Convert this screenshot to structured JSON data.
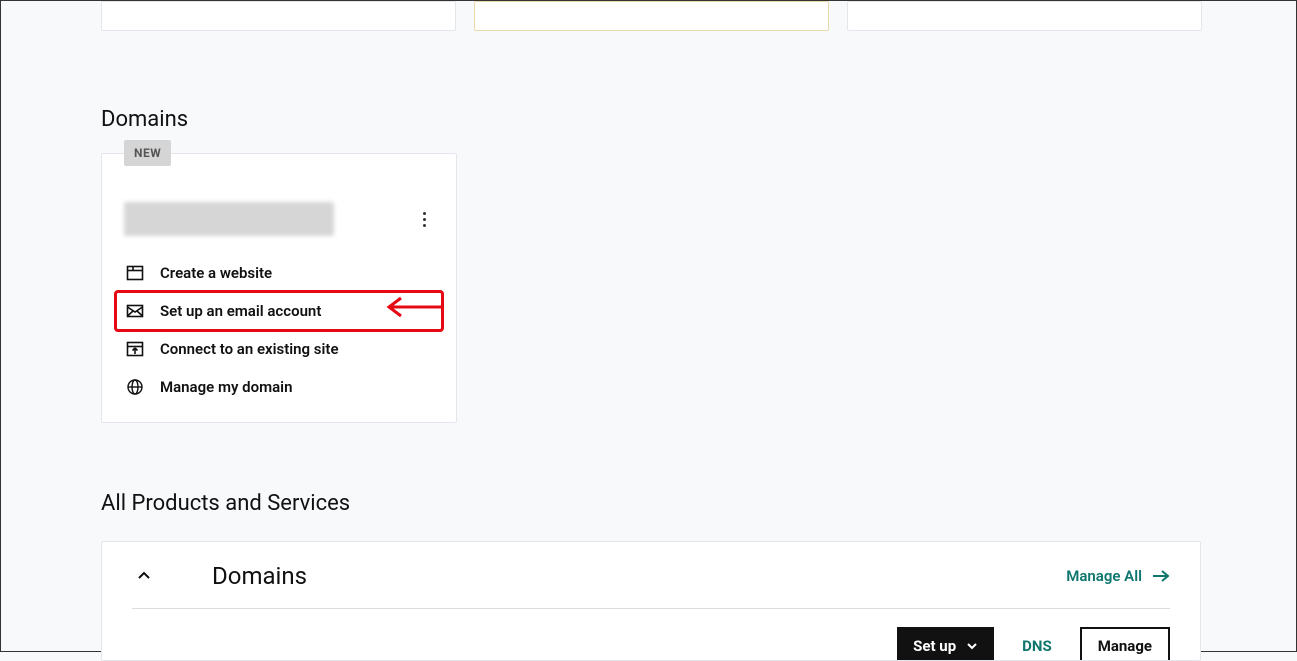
{
  "domains_section": {
    "title": "Domains",
    "new_badge": "NEW",
    "actions": {
      "create_website": "Create a website",
      "setup_email": "Set up an email account",
      "connect_site": "Connect to an existing site",
      "manage_domain": "Manage my domain"
    }
  },
  "all_products": {
    "title": "All Products and Services",
    "panel_title": "Domains",
    "manage_all": "Manage All",
    "setup_button": "Set up",
    "dns_link": "DNS",
    "manage_button": "Manage"
  },
  "colors": {
    "highlight": "#e50914",
    "teal": "#0f766e"
  }
}
